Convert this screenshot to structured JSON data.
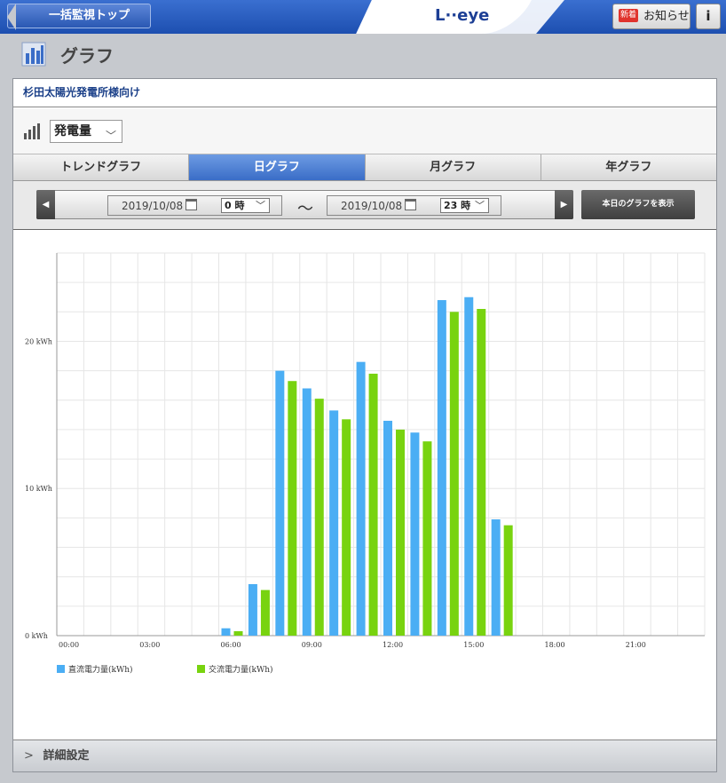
{
  "header": {
    "back_label": "一括監視トップ",
    "logo": "L··eye",
    "notice_badge": "新着",
    "notice_label": "お知らせ",
    "info_label": "i"
  },
  "page": {
    "title": "グラフ"
  },
  "plant": {
    "name": "杉田太陽光発電所様向け"
  },
  "metric": {
    "selected": "発電量",
    "chevron": "﹀"
  },
  "tabs": [
    {
      "label": "トレンドグラフ"
    },
    {
      "label": "日グラフ"
    },
    {
      "label": "月グラフ"
    },
    {
      "label": "年グラフ"
    }
  ],
  "date_range": {
    "prev": "◀",
    "next": "▶",
    "start_date": "2019/10/08",
    "start_hour": "0 時",
    "separator": "〜",
    "end_date": "2019/10/08",
    "end_hour": "23 時",
    "chevron": "﹀",
    "today_button": "本日のグラフを表示"
  },
  "detail": {
    "chevron": ">",
    "label": "詳細設定"
  },
  "colors": {
    "dc": "#4baef4",
    "ac": "#78d30f",
    "header": "#2458bf"
  },
  "chart_data": {
    "type": "bar",
    "categories": [
      "00:00",
      "01:00",
      "02:00",
      "03:00",
      "04:00",
      "05:00",
      "06:00",
      "07:00",
      "08:00",
      "09:00",
      "10:00",
      "11:00",
      "12:00",
      "13:00",
      "14:00",
      "15:00",
      "16:00",
      "17:00",
      "18:00",
      "19:00",
      "20:00",
      "21:00",
      "22:00",
      "23:00"
    ],
    "x_tick_labels": [
      "00:00",
      "03:00",
      "06:00",
      "09:00",
      "12:00",
      "15:00",
      "18:00",
      "21:00"
    ],
    "y_tick_labels": [
      "0 kWh",
      "10 kWh",
      "20 kWh"
    ],
    "ylim": [
      0,
      26
    ],
    "grid": true,
    "legend_position": "bottom-left",
    "series": [
      {
        "name": "直流電力量(kWh)",
        "color": "#4baef4",
        "values": [
          0,
          0,
          0,
          0,
          0,
          0,
          0.5,
          3.5,
          18.0,
          16.8,
          15.3,
          18.6,
          14.6,
          13.8,
          22.8,
          23.0,
          7.9,
          0,
          0,
          0,
          0,
          0,
          0,
          0
        ]
      },
      {
        "name": "交流電力量(kWh)",
        "color": "#78d30f",
        "values": [
          0,
          0,
          0,
          0,
          0,
          0,
          0.3,
          3.1,
          17.3,
          16.1,
          14.7,
          17.8,
          14.0,
          13.2,
          22.0,
          22.2,
          7.5,
          0,
          0,
          0,
          0,
          0,
          0,
          0
        ]
      }
    ]
  }
}
